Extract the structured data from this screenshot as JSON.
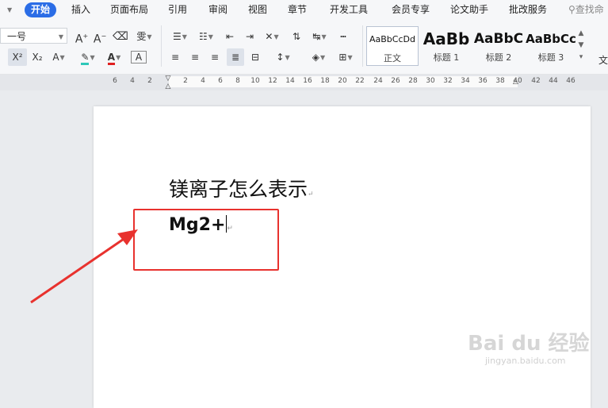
{
  "menubar": {
    "items": [
      "开始",
      "插入",
      "页面布局",
      "引用",
      "审阅",
      "视图",
      "章节",
      "开发工具",
      "会员专享",
      "论文助手",
      "批改服务"
    ],
    "active_index": 0,
    "search": "查找命"
  },
  "toolbar": {
    "font_size": "一号",
    "style_gallery": [
      {
        "sample": "AaBbCcDd",
        "name": "正文"
      },
      {
        "sample": "AaBb",
        "name": "标题 1"
      },
      {
        "sample": "AaBbC",
        "name": "标题 2"
      },
      {
        "sample": "AaBbCc",
        "name": "标题 3"
      }
    ],
    "text_effects": "文"
  },
  "ruler": {
    "numbers": [
      "6",
      "4",
      "2",
      "2",
      "4",
      "6",
      "8",
      "10",
      "12",
      "14",
      "16",
      "18",
      "20",
      "22",
      "24",
      "26",
      "28",
      "30",
      "32",
      "34",
      "36",
      "38",
      "40",
      "42",
      "44",
      "46"
    ]
  },
  "document": {
    "para1": "镁离子怎么表示",
    "para2": "Mg2+"
  },
  "watermark": {
    "logo": "Bai du 经验",
    "url": "jingyan.baidu.com"
  },
  "colors": {
    "accent": "#2b6de6",
    "annotation_red": "#e8322e",
    "highlight_bar": "#2ec7b9",
    "font_color_bar": "#e02020"
  }
}
